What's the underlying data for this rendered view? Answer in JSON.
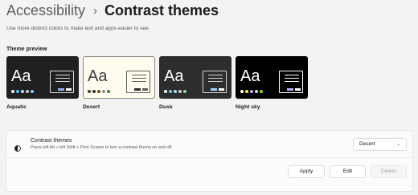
{
  "breadcrumb": {
    "parent": "Accessibility",
    "separator": "›",
    "current": "Contrast themes"
  },
  "description": "Use more distinct colors to make text and apps easier to see.",
  "preview_title": "Theme preview",
  "themes": [
    {
      "name": "Aquatic",
      "sample": "Aa",
      "selected": false,
      "bg": "#202020",
      "fg": "#ffffff",
      "panel_bg": "#202020",
      "panel_border": "#e0e0e0",
      "line": "#e0e0e0",
      "accent": "#8ab4f8",
      "accent2": "#ffffff",
      "dots": [
        "#ffffff",
        "#4cc2ff",
        "#b1e3ff",
        "#c9c9c9",
        "#73d0ff"
      ]
    },
    {
      "name": "Desert",
      "sample": "Aa",
      "selected": true,
      "bg": "#fffbef",
      "fg": "#3d3d3d",
      "panel_bg": "#fffbef",
      "panel_border": "#5c5c5c",
      "line": "#5c5c5c",
      "accent": "#2b2b2b",
      "accent2": "#5c5c5c",
      "dots": [
        "#3d3d3d",
        "#2b2b2b",
        "#6b4d00",
        "#8f8f8f",
        "#3c7d38"
      ]
    },
    {
      "name": "Dusk",
      "sample": "Aa",
      "selected": false,
      "bg": "#2d2d2d",
      "fg": "#ffffff",
      "panel_bg": "#2d2d2d",
      "panel_border": "#d8d8d8",
      "line": "#d8d8d8",
      "accent": "#9ad6ff",
      "accent2": "#ffffff",
      "dots": [
        "#ffffff",
        "#7ad0c6",
        "#a5e8ff",
        "#d0d0d0",
        "#8be0a8"
      ]
    },
    {
      "name": "Night sky",
      "sample": "Aa",
      "selected": false,
      "bg": "#000000",
      "fg": "#ffffff",
      "panel_bg": "#000000",
      "panel_border": "#ffffff",
      "line": "#ffffff",
      "accent": "#c5a8ff",
      "accent2": "#ffffff",
      "dots": [
        "#ffffff",
        "#ffff00",
        "#c5a8ff",
        "#d8d8d8",
        "#8ee000"
      ]
    }
  ],
  "panel": {
    "title": "Contrast themes",
    "subtitle": "Press left Alt + left Shift + Print Screen to turn a contrast theme on and off",
    "selected_theme": "Desert",
    "apply_label": "Apply",
    "edit_label": "Edit",
    "delete_label": "Delete"
  }
}
